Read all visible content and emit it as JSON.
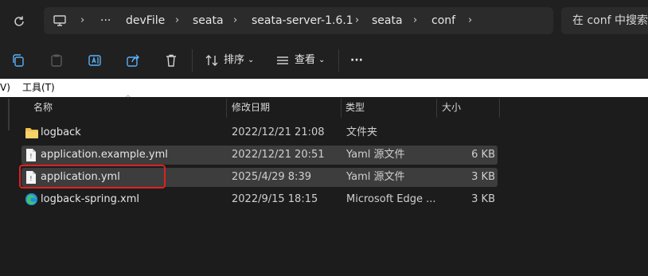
{
  "breadcrumb": {
    "ellipsis": "···",
    "items": [
      "devFile",
      "seata",
      "seata-server-1.6.1",
      "seata",
      "conf"
    ]
  },
  "search": {
    "placeholder": "在 conf 中搜索"
  },
  "toolbar": {
    "sort_label": "排序",
    "view_label": "查看",
    "more_label": "···"
  },
  "menubar": {
    "partial_left": "V)",
    "tools": "工具(T)"
  },
  "columns": {
    "name": "名称",
    "modified": "修改日期",
    "type": "类型",
    "size": "大小"
  },
  "files": [
    {
      "name": "logback",
      "modified": "2022/12/21 21:08",
      "type": "文件夹",
      "size": "",
      "icon": "folder-icon"
    },
    {
      "name": "application.example.yml",
      "modified": "2022/12/21 20:51",
      "type": "Yaml 源文件",
      "size": "6 KB",
      "icon": "file-icon"
    },
    {
      "name": "application.yml",
      "modified": "2025/4/29 8:39",
      "type": "Yaml 源文件",
      "size": "3 KB",
      "icon": "file-icon"
    },
    {
      "name": "logback-spring.xml",
      "modified": "2022/9/15 18:15",
      "type": "Microsoft Edge ...",
      "size": "3 KB",
      "icon": "edge-icon"
    }
  ],
  "colors": {
    "accent_highlight": "#e02020",
    "folder": "#f2c14e",
    "edge_blue": "#1b8fe0",
    "edge_green": "#46c06e"
  }
}
